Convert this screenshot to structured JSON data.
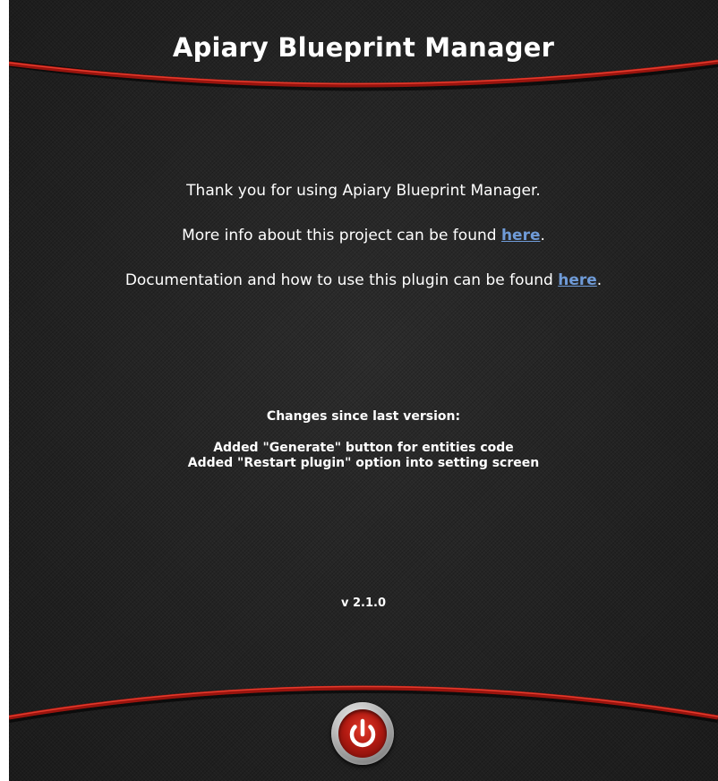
{
  "window": {
    "title": "Apiary Blueprint Manager"
  },
  "intro": {
    "thanks": "Thank you for using Apiary Blueprint Manager.",
    "project_info_prefix": "More info about this project can be found ",
    "project_info_link": "here",
    "project_info_suffix": ".",
    "docs_prefix": "Documentation and how to use this plugin can be found ",
    "docs_link": "here",
    "docs_suffix": "."
  },
  "changes": {
    "heading": "Changes since last version:",
    "items": [
      "Added \"Generate\" button for entities code",
      "Added \"Restart plugin\" option into setting screen"
    ]
  },
  "version": "v 2.1.0",
  "power_button": {
    "icon": "power-icon"
  },
  "colors": {
    "background": "#222222",
    "accent_red": "#b01810",
    "link": "#6f9bd8",
    "text": "#ffffff"
  }
}
